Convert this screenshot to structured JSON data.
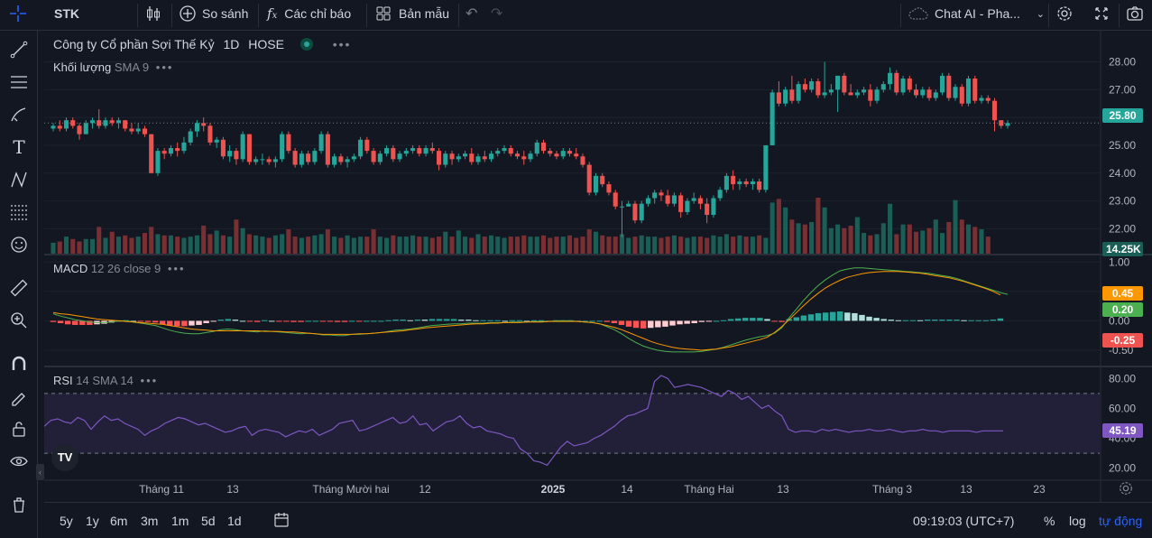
{
  "toolbar": {
    "symbol": "STK",
    "compare_label": "So sánh",
    "indicators_label": "Các chỉ báo",
    "templates_label": "Bản mẫu",
    "chat_label": "Chat AI - Pha..."
  },
  "legend": {
    "company": "Công ty Cổ phần Sợi Thế Kỷ",
    "interval": "1D",
    "exchange": "HOSE",
    "volume_name": "Khối lượng",
    "volume_params": "SMA 9",
    "macd_name": "MACD",
    "macd_params": "12 26 close 9",
    "rsi_name": "RSI",
    "rsi_params": "14 SMA 14"
  },
  "price_axis": {
    "ticks": [
      "28.00",
      "27.00",
      "26.00",
      "25.00",
      "24.00",
      "23.00",
      "22.00"
    ],
    "last_price": "25.80",
    "last_volume": "14.25K"
  },
  "macd_axis": {
    "ticks": [
      "1.00",
      "0.50",
      "0.00",
      "-0.50"
    ],
    "macd_value": "0.45",
    "signal_value": "0.20",
    "hist_value": "-0.25"
  },
  "rsi_axis": {
    "ticks": [
      "80.00",
      "60.00",
      "40.00",
      "20.00"
    ],
    "rsi_value": "45.19"
  },
  "time_axis": {
    "labels": [
      "Tháng 11",
      "13",
      "Tháng Mười hai",
      "12",
      "2025",
      "14",
      "Tháng Hai",
      "13",
      "Tháng 3",
      "13",
      "23"
    ]
  },
  "bottom": {
    "ranges": [
      "5y",
      "1y",
      "6m",
      "3m",
      "1m",
      "5d",
      "1d"
    ],
    "clock": "09:19:03 (UTC+7)",
    "pct": "%",
    "log": "log",
    "auto": "tự động"
  },
  "colors": {
    "up": "#26a69a",
    "down": "#ef5350",
    "macd_line": "#4caf50",
    "signal_line": "#ff9800",
    "rsi_line": "#7e57c2",
    "accent": "#2962ff"
  },
  "chart_data": {
    "type": "candlestick",
    "price_ylim": [
      21.3,
      28.6
    ],
    "candles": [
      [
        25.6,
        25.8,
        25.5,
        25.7
      ],
      [
        25.7,
        25.9,
        25.5,
        25.6
      ],
      [
        25.6,
        26.0,
        25.5,
        25.9
      ],
      [
        25.9,
        26.0,
        25.6,
        25.7
      ],
      [
        25.7,
        25.8,
        25.2,
        25.4
      ],
      [
        25.4,
        25.9,
        25.4,
        25.8
      ],
      [
        25.8,
        26.0,
        25.6,
        25.9
      ],
      [
        25.9,
        26.3,
        25.6,
        25.7
      ],
      [
        25.7,
        26.0,
        25.6,
        25.9
      ],
      [
        25.9,
        26.0,
        25.7,
        25.8
      ],
      [
        25.8,
        26.0,
        25.6,
        25.9
      ],
      [
        25.9,
        25.9,
        25.5,
        25.6
      ],
      [
        25.6,
        25.8,
        25.4,
        25.5
      ],
      [
        25.5,
        25.8,
        25.4,
        25.6
      ],
      [
        25.6,
        25.7,
        25.3,
        25.4
      ],
      [
        25.4,
        25.4,
        24.0,
        24.0
      ],
      [
        24.0,
        24.9,
        23.9,
        24.8
      ],
      [
        24.8,
        24.9,
        24.5,
        24.7
      ],
      [
        24.7,
        25.0,
        24.6,
        24.9
      ],
      [
        24.9,
        25.1,
        24.6,
        24.8
      ],
      [
        24.8,
        25.3,
        24.7,
        25.1
      ],
      [
        25.1,
        25.6,
        25.0,
        25.5
      ],
      [
        25.5,
        25.9,
        25.3,
        25.8
      ],
      [
        25.8,
        26.0,
        25.5,
        25.7
      ],
      [
        25.7,
        25.8,
        25.0,
        25.1
      ],
      [
        25.1,
        25.3,
        24.9,
        25.2
      ],
      [
        25.2,
        25.3,
        24.5,
        24.6
      ],
      [
        24.6,
        25.0,
        24.4,
        24.8
      ],
      [
        24.8,
        24.9,
        24.3,
        24.5
      ],
      [
        24.5,
        25.5,
        24.4,
        25.4
      ],
      [
        25.4,
        25.4,
        24.3,
        24.4
      ],
      [
        24.4,
        24.6,
        24.3,
        24.5
      ],
      [
        24.5,
        24.7,
        24.3,
        24.5
      ],
      [
        24.5,
        24.6,
        24.3,
        24.4
      ],
      [
        24.4,
        24.6,
        24.2,
        24.5
      ],
      [
        24.5,
        25.5,
        24.4,
        25.4
      ],
      [
        25.4,
        25.5,
        24.7,
        24.8
      ],
      [
        24.8,
        24.9,
        24.2,
        24.3
      ],
      [
        24.3,
        24.8,
        24.2,
        24.7
      ],
      [
        24.7,
        24.8,
        24.3,
        24.4
      ],
      [
        24.4,
        24.9,
        24.3,
        24.8
      ],
      [
        24.8,
        25.5,
        24.7,
        25.4
      ],
      [
        25.4,
        25.5,
        24.2,
        24.3
      ],
      [
        24.3,
        24.7,
        24.2,
        24.6
      ],
      [
        24.6,
        24.7,
        24.3,
        24.4
      ],
      [
        24.4,
        24.6,
        24.2,
        24.5
      ],
      [
        24.5,
        24.7,
        24.4,
        24.6
      ],
      [
        24.6,
        25.3,
        24.5,
        25.2
      ],
      [
        25.2,
        25.3,
        24.7,
        24.8
      ],
      [
        24.8,
        24.9,
        24.3,
        24.4
      ],
      [
        24.4,
        24.8,
        24.3,
        24.7
      ],
      [
        24.7,
        25.0,
        24.6,
        24.9
      ],
      [
        24.9,
        25.0,
        24.4,
        24.5
      ],
      [
        24.5,
        24.8,
        24.4,
        24.7
      ],
      [
        24.7,
        24.9,
        24.6,
        24.8
      ],
      [
        24.8,
        25.0,
        24.7,
        24.9
      ],
      [
        24.9,
        25.0,
        24.6,
        24.7
      ],
      [
        24.7,
        25.0,
        24.6,
        24.9
      ],
      [
        24.9,
        25.1,
        24.7,
        24.8
      ],
      [
        24.8,
        24.9,
        24.1,
        24.3
      ],
      [
        24.3,
        24.8,
        24.2,
        24.7
      ],
      [
        24.7,
        24.8,
        24.3,
        24.5
      ],
      [
        24.5,
        24.7,
        24.4,
        24.6
      ],
      [
        24.6,
        24.8,
        24.5,
        24.7
      ],
      [
        24.7,
        24.9,
        24.3,
        24.4
      ],
      [
        24.4,
        24.7,
        24.3,
        24.6
      ],
      [
        24.6,
        24.8,
        24.4,
        24.5
      ],
      [
        24.5,
        24.8,
        24.4,
        24.7
      ],
      [
        24.7,
        24.9,
        24.6,
        24.8
      ],
      [
        24.8,
        25.0,
        24.7,
        24.9
      ],
      [
        24.9,
        25.0,
        24.6,
        24.7
      ],
      [
        24.7,
        24.8,
        24.5,
        24.6
      ],
      [
        24.6,
        24.8,
        24.3,
        24.5
      ],
      [
        24.5,
        24.8,
        24.4,
        24.7
      ],
      [
        24.7,
        25.2,
        24.6,
        25.1
      ],
      [
        25.1,
        25.2,
        24.7,
        24.8
      ],
      [
        24.8,
        24.9,
        24.6,
        24.7
      ],
      [
        24.7,
        24.8,
        24.5,
        24.6
      ],
      [
        24.6,
        24.9,
        24.5,
        24.8
      ],
      [
        24.8,
        24.9,
        24.6,
        24.7
      ],
      [
        24.7,
        24.9,
        24.5,
        24.6
      ],
      [
        24.6,
        24.7,
        24.2,
        24.3
      ],
      [
        24.3,
        24.4,
        23.2,
        23.3
      ],
      [
        23.3,
        24.0,
        23.2,
        23.9
      ],
      [
        23.9,
        24.0,
        23.5,
        23.6
      ],
      [
        23.6,
        23.7,
        23.2,
        23.3
      ],
      [
        23.3,
        23.4,
        22.7,
        22.8
      ],
      [
        22.8,
        23.0,
        21.7,
        22.8
      ],
      [
        22.8,
        23.0,
        22.8,
        22.9
      ],
      [
        22.9,
        23.0,
        22.2,
        22.3
      ],
      [
        22.3,
        23.0,
        22.2,
        22.9
      ],
      [
        22.9,
        23.2,
        22.8,
        23.1
      ],
      [
        23.1,
        23.4,
        22.9,
        23.3
      ],
      [
        23.3,
        23.4,
        23.0,
        23.2
      ],
      [
        23.2,
        23.4,
        22.8,
        22.9
      ],
      [
        22.9,
        23.3,
        22.8,
        23.2
      ],
      [
        23.2,
        23.3,
        22.4,
        22.6
      ],
      [
        22.6,
        23.1,
        22.5,
        23.0
      ],
      [
        23.0,
        23.3,
        22.9,
        23.1
      ],
      [
        23.1,
        23.2,
        22.7,
        22.9
      ],
      [
        22.9,
        23.1,
        22.2,
        22.5
      ],
      [
        22.5,
        23.2,
        22.4,
        23.1
      ],
      [
        23.1,
        23.5,
        23.0,
        23.4
      ],
      [
        23.4,
        24.0,
        23.3,
        23.9
      ],
      [
        23.9,
        24.1,
        23.4,
        23.6
      ],
      [
        23.6,
        23.8,
        23.4,
        23.7
      ],
      [
        23.7,
        23.8,
        23.5,
        23.6
      ],
      [
        23.6,
        23.8,
        23.4,
        23.7
      ],
      [
        23.7,
        23.8,
        23.3,
        23.4
      ],
      [
        23.4,
        25.0,
        23.3,
        25.0
      ],
      [
        25.0,
        27.0,
        25.2,
        26.9
      ],
      [
        26.9,
        27.3,
        26.4,
        26.5
      ],
      [
        26.5,
        27.1,
        26.4,
        27.0
      ],
      [
        27.0,
        27.5,
        26.5,
        26.6
      ],
      [
        26.6,
        27.3,
        26.5,
        27.2
      ],
      [
        27.2,
        27.4,
        26.9,
        27.0
      ],
      [
        27.0,
        27.4,
        26.9,
        27.3
      ],
      [
        27.3,
        27.4,
        26.7,
        26.8
      ],
      [
        26.8,
        28.0,
        26.7,
        26.9
      ],
      [
        26.9,
        27.2,
        26.8,
        27.0
      ],
      [
        27.0,
        27.5,
        26.2,
        27.5
      ],
      [
        27.5,
        27.6,
        26.8,
        26.9
      ],
      [
        26.9,
        27.2,
        26.8,
        26.8
      ],
      [
        26.8,
        27.0,
        26.7,
        26.9
      ],
      [
        26.9,
        27.1,
        26.8,
        27.0
      ],
      [
        27.0,
        27.2,
        26.4,
        26.6
      ],
      [
        26.6,
        27.1,
        26.5,
        27.0
      ],
      [
        27.0,
        27.3,
        26.9,
        27.2
      ],
      [
        27.2,
        27.8,
        27.0,
        27.6
      ],
      [
        27.6,
        27.7,
        26.8,
        26.9
      ],
      [
        26.9,
        27.5,
        26.8,
        27.4
      ],
      [
        27.4,
        27.5,
        26.9,
        27.0
      ],
      [
        27.0,
        27.2,
        26.7,
        26.8
      ],
      [
        26.8,
        27.1,
        26.7,
        27.0
      ],
      [
        27.0,
        27.1,
        26.6,
        26.7
      ],
      [
        26.7,
        27.0,
        26.6,
        26.9
      ],
      [
        26.9,
        27.6,
        26.8,
        27.5
      ],
      [
        27.5,
        27.6,
        26.6,
        26.7
      ],
      [
        26.7,
        27.2,
        26.6,
        27.1
      ],
      [
        27.1,
        27.2,
        26.4,
        26.5
      ],
      [
        26.5,
        27.5,
        26.4,
        27.4
      ],
      [
        27.4,
        27.5,
        26.5,
        26.6
      ],
      [
        26.6,
        26.8,
        26.5,
        26.7
      ],
      [
        26.7,
        26.8,
        26.5,
        26.6
      ],
      [
        26.6,
        26.7,
        25.5,
        25.9
      ],
      [
        25.9,
        25.9,
        25.6,
        25.7
      ],
      [
        25.7,
        25.9,
        25.6,
        25.8
      ]
    ],
    "volume": [
      9,
      10,
      14,
      12,
      10,
      12,
      12,
      22,
      13,
      18,
      14,
      15,
      13,
      14,
      17,
      22,
      16,
      15,
      15,
      14,
      13,
      14,
      15,
      23,
      16,
      19,
      15,
      14,
      28,
      21,
      16,
      15,
      14,
      13,
      15,
      16,
      20,
      14,
      13,
      14,
      15,
      16,
      20,
      14,
      13,
      15,
      13,
      14,
      14,
      20,
      14,
      13,
      15,
      14,
      14,
      15,
      14,
      14,
      13,
      14,
      18,
      14,
      19,
      14,
      13,
      16,
      14,
      15,
      14,
      13,
      14,
      14,
      15,
      14,
      14,
      15,
      13,
      14,
      14,
      15,
      13,
      14,
      20,
      18,
      15,
      14,
      14,
      16,
      13,
      14,
      15,
      14,
      14,
      13,
      14,
      15,
      14,
      13,
      14,
      14,
      13,
      15,
      14,
      16,
      14,
      15,
      14,
      14,
      15,
      13,
      42,
      45,
      38,
      28,
      25,
      24,
      26,
      46,
      38,
      21,
      24,
      21,
      23,
      30,
      17,
      15,
      16,
      25,
      41,
      16,
      24,
      24,
      18,
      19,
      21,
      28,
      17,
      26,
      44,
      28,
      24,
      22,
      20,
      14
    ],
    "macd": [
      0.12,
      0.08,
      0.05,
      0.02,
      0.0,
      -0.02,
      -0.03,
      -0.03,
      -0.02,
      0.0,
      0.0,
      -0.02,
      -0.04,
      -0.06,
      -0.08,
      -0.12,
      -0.16,
      -0.19,
      -0.21,
      -0.22,
      -0.22,
      -0.2,
      -0.18,
      -0.15,
      -0.14,
      -0.15,
      -0.17,
      -0.18,
      -0.19,
      -0.17,
      -0.18,
      -0.19,
      -0.2,
      -0.21,
      -0.22,
      -0.21,
      -0.22,
      -0.24,
      -0.24,
      -0.25,
      -0.25,
      -0.23,
      -0.23,
      -0.22,
      -0.21,
      -0.2,
      -0.18,
      -0.16,
      -0.15,
      -0.14,
      -0.12,
      -0.1,
      -0.08,
      -0.07,
      -0.06,
      -0.05,
      -0.05,
      -0.04,
      -0.04,
      -0.04,
      -0.03,
      -0.03,
      -0.03,
      -0.02,
      -0.02,
      -0.02,
      -0.01,
      -0.01,
      -0.01,
      0.0,
      0.0,
      0.0,
      -0.01,
      -0.02,
      -0.03,
      -0.05,
      -0.1,
      -0.15,
      -0.22,
      -0.3,
      -0.37,
      -0.43,
      -0.47,
      -0.5,
      -0.52,
      -0.53,
      -0.53,
      -0.53,
      -0.53,
      -0.52,
      -0.5,
      -0.48,
      -0.45,
      -0.41,
      -0.37,
      -0.33,
      -0.3,
      -0.27,
      -0.25,
      -0.21,
      -0.12,
      0.05,
      0.2,
      0.35,
      0.48,
      0.6,
      0.7,
      0.78,
      0.85,
      0.88,
      0.9,
      0.9,
      0.89,
      0.88,
      0.87,
      0.86,
      0.85,
      0.84,
      0.83,
      0.82,
      0.81,
      0.79,
      0.77,
      0.75,
      0.72,
      0.68,
      0.64,
      0.6,
      0.56,
      0.52,
      0.48,
      0.45
    ],
    "signal": [
      0.14,
      0.12,
      0.11,
      0.09,
      0.07,
      0.05,
      0.03,
      0.02,
      0.01,
      0.0,
      -0.01,
      -0.02,
      -0.03,
      -0.04,
      -0.05,
      -0.06,
      -0.08,
      -0.1,
      -0.12,
      -0.14,
      -0.15,
      -0.16,
      -0.17,
      -0.17,
      -0.17,
      -0.17,
      -0.17,
      -0.17,
      -0.17,
      -0.18,
      -0.18,
      -0.18,
      -0.19,
      -0.19,
      -0.2,
      -0.21,
      -0.22,
      -0.23,
      -0.23,
      -0.23,
      -0.23,
      -0.23,
      -0.22,
      -0.22,
      -0.21,
      -0.2,
      -0.19,
      -0.18,
      -0.17,
      -0.15,
      -0.14,
      -0.12,
      -0.11,
      -0.1,
      -0.09,
      -0.08,
      -0.07,
      -0.06,
      -0.05,
      -0.05,
      -0.04,
      -0.04,
      -0.03,
      -0.03,
      -0.03,
      -0.02,
      -0.02,
      -0.02,
      -0.01,
      -0.01,
      -0.01,
      -0.01,
      -0.01,
      -0.02,
      -0.03,
      -0.05,
      -0.08,
      -0.11,
      -0.15,
      -0.2,
      -0.25,
      -0.3,
      -0.35,
      -0.39,
      -0.42,
      -0.45,
      -0.47,
      -0.48,
      -0.49,
      -0.5,
      -0.49,
      -0.48,
      -0.46,
      -0.44,
      -0.41,
      -0.38,
      -0.35,
      -0.32,
      -0.28,
      -0.2,
      -0.1,
      0.02,
      0.14,
      0.26,
      0.37,
      0.47,
      0.56,
      0.63,
      0.69,
      0.74,
      0.77,
      0.8,
      0.82,
      0.83,
      0.84,
      0.84,
      0.84,
      0.83,
      0.82,
      0.81,
      0.79,
      0.77,
      0.75,
      0.73,
      0.7,
      0.67,
      0.63,
      0.59,
      0.55,
      0.5,
      0.44
    ],
    "rsi": [
      48,
      52,
      53,
      51,
      50,
      54,
      52,
      46,
      51,
      55,
      52,
      53,
      50,
      48,
      46,
      42,
      45,
      47,
      50,
      52,
      54,
      53,
      51,
      49,
      50,
      48,
      46,
      44,
      45,
      47,
      48,
      42,
      45,
      46,
      45,
      44,
      41,
      43,
      45,
      44,
      46,
      42,
      44,
      46,
      50,
      51,
      52,
      45,
      46,
      48,
      50,
      52,
      54,
      50,
      51,
      55,
      49,
      50,
      45,
      48,
      51,
      52,
      55,
      50,
      47,
      48,
      45,
      44,
      43,
      41,
      40,
      33,
      30,
      25,
      24,
      22,
      28,
      34,
      38,
      35,
      36,
      37,
      40,
      42,
      45,
      48,
      52,
      55,
      56,
      58,
      60,
      78,
      82,
      80,
      74,
      75,
      76,
      75,
      74,
      72,
      70,
      68,
      72,
      70,
      66,
      68,
      64,
      60,
      62,
      58,
      55,
      46,
      44,
      45,
      45,
      44,
      46,
      45,
      46,
      45,
      44,
      45,
      45,
      46,
      45,
      45,
      46,
      45,
      44,
      45,
      45,
      46,
      45,
      45,
      44,
      45,
      45,
      45,
      45,
      44,
      45,
      45,
      45,
      45
    ],
    "rsi_ylim": [
      15,
      85
    ],
    "rsi_bands": [
      70,
      30
    ]
  }
}
